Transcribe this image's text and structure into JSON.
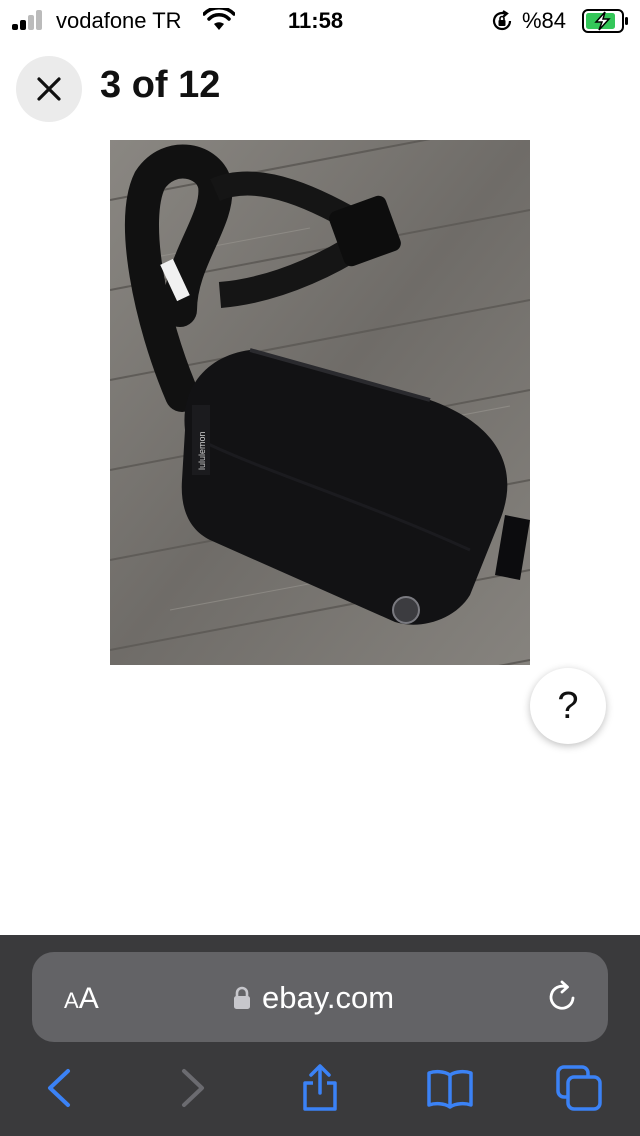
{
  "status_bar": {
    "carrier": "vodafone TR",
    "time": "11:58",
    "battery_percent": "%84",
    "icons": [
      "signal-icon",
      "wifi-icon",
      "orientation-lock-icon",
      "battery-charging-icon"
    ]
  },
  "viewer": {
    "title": "3 of 12",
    "close_icon": "close-icon",
    "help_label": "?"
  },
  "photo": {
    "brand_text": "lululemon"
  },
  "browser": {
    "text_size_label_small": "A",
    "text_size_label_large": "A",
    "url": "ebay.com",
    "icons": [
      "lock-icon",
      "reload-icon",
      "back-icon",
      "forward-icon",
      "share-icon",
      "bookmarks-icon",
      "tabs-icon"
    ]
  },
  "colors": {
    "accent_blue": "#1a73e8",
    "chrome_dark": "#3a3a3c",
    "address_bar": "#636366",
    "battery_green": "#34c759"
  }
}
